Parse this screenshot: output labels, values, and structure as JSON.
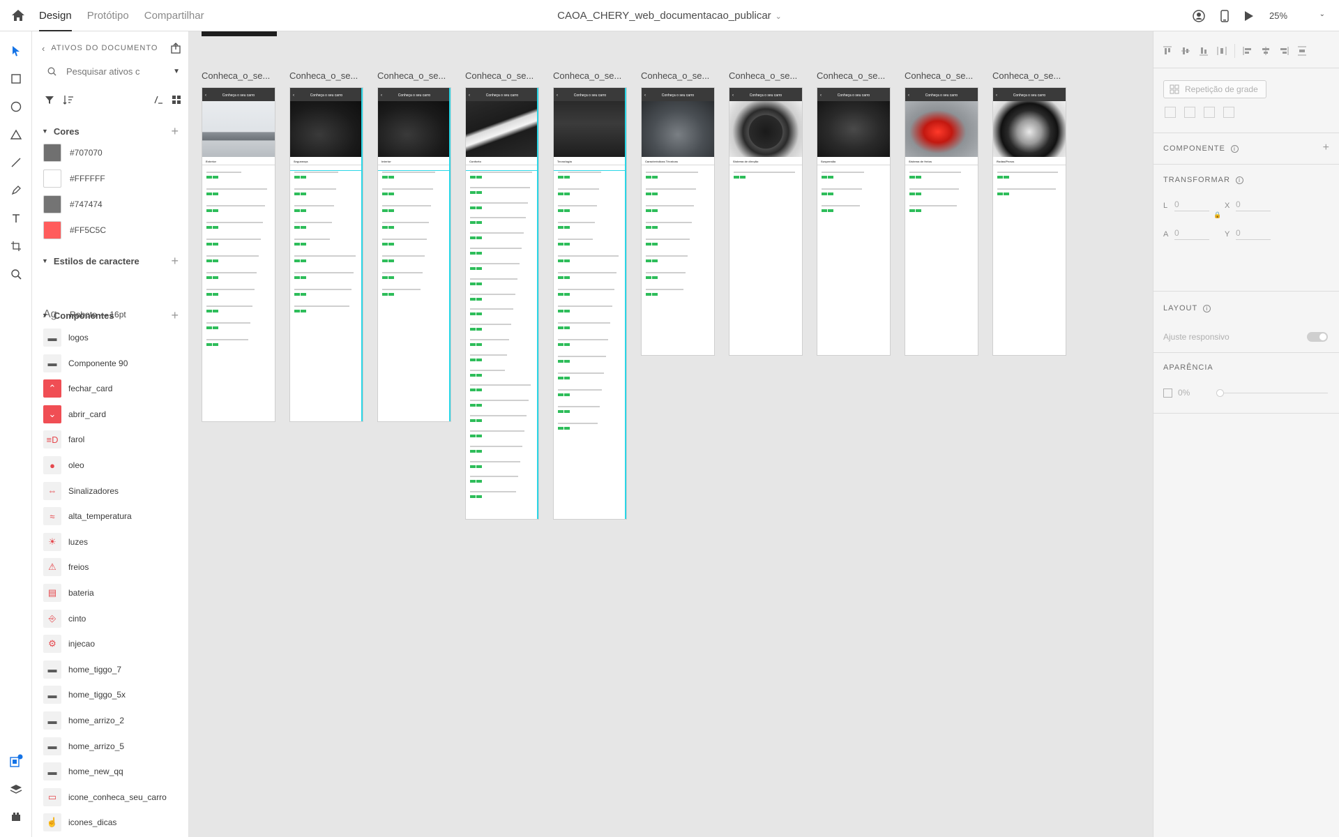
{
  "app": {
    "tabs": [
      {
        "label": "Design",
        "active": true
      },
      {
        "label": "Protótipo",
        "active": false
      },
      {
        "label": "Compartilhar",
        "active": false
      }
    ],
    "document_title": "CAOA_CHERY_web_documentacao_publicar",
    "zoom": "25%"
  },
  "assets": {
    "title": "ATIVOS DO DOCUMENTO",
    "search_placeholder": "Pesquisar ativos c",
    "colors_title": "Cores",
    "colors": [
      {
        "label": "#707070",
        "hex": "#707070"
      },
      {
        "label": "#FFFFFF",
        "hex": "#FFFFFF"
      },
      {
        "label": "#747474",
        "hex": "#747474"
      },
      {
        "label": "#FF5C5C",
        "hex": "#FF5C5C"
      }
    ],
    "char_styles_title": "Estilos de caractere",
    "char_style": {
      "glyph": "Ag",
      "label": "Roboto — 16pt"
    },
    "components_title": "Componentes",
    "components": [
      {
        "label": "logos",
        "icon": "logos-icon"
      },
      {
        "label": "Componente 90",
        "icon": "component-icon"
      },
      {
        "label": "fechar_card",
        "icon": "chevron-up-icon"
      },
      {
        "label": "abrir_card",
        "icon": "chevron-down-icon"
      },
      {
        "label": "farol",
        "icon": "headlight-icon"
      },
      {
        "label": "oleo",
        "icon": "oil-can-icon"
      },
      {
        "label": "Sinalizadores",
        "icon": "turn-signal-icon"
      },
      {
        "label": "alta_temperatura",
        "icon": "temperature-icon"
      },
      {
        "label": "luzes",
        "icon": "light-icon"
      },
      {
        "label": "freios",
        "icon": "brake-warning-icon"
      },
      {
        "label": "bateria",
        "icon": "battery-icon"
      },
      {
        "label": "cinto",
        "icon": "seatbelt-icon"
      },
      {
        "label": "injecao",
        "icon": "engine-icon"
      },
      {
        "label": "home_tiggo_7",
        "icon": "car-icon"
      },
      {
        "label": "home_tiggo_5x",
        "icon": "car-icon"
      },
      {
        "label": "home_arrizo_2",
        "icon": "car-icon"
      },
      {
        "label": "home_arrizo_5",
        "icon": "car-icon"
      },
      {
        "label": "home_new_qq",
        "icon": "car-icon"
      },
      {
        "label": "icone_conheca_seu_carro",
        "icon": "car-outline-icon"
      },
      {
        "label": "icones_dicas",
        "icon": "thumbs-up-icon"
      }
    ]
  },
  "canvas": {
    "artboards": [
      {
        "label": "Conheca_o_se...",
        "header": "Conheça o seu carro",
        "section": "Exterior",
        "rows": 11,
        "selected": false,
        "photo": "car-side"
      },
      {
        "label": "Conheca_o_se...",
        "header": "Conheça o seu carro",
        "section": "Segurança",
        "rows": 9,
        "selected": true,
        "photo": "seats"
      },
      {
        "label": "Conheca_o_se...",
        "header": "Conheça o seu carro",
        "section": "Interior",
        "rows": 8,
        "selected": true,
        "photo": "seats"
      },
      {
        "label": "Conheca_o_se...",
        "header": "Conheça o seu carro",
        "section": "Conforto",
        "rows": 22,
        "selected": true,
        "photo": "sunroof"
      },
      {
        "label": "Conheca_o_se...",
        "header": "Conheça o seu carro",
        "section": "Tecnologia",
        "rows": 16,
        "selected": true,
        "photo": "dashboard"
      },
      {
        "label": "Conheca_o_se...",
        "header": "Conheça o seu carro",
        "section": "Características Técnicas",
        "rows": 8,
        "selected": false,
        "photo": "car-front"
      },
      {
        "label": "Conheca_o_se...",
        "header": "Conheça o seu carro",
        "section": "Sistema de direção",
        "rows": 1,
        "selected": false,
        "photo": "wheel"
      },
      {
        "label": "Conheca_o_se...",
        "header": "Conheça o seu carro",
        "section": "Suspensão",
        "rows": 3,
        "selected": false,
        "photo": "engine"
      },
      {
        "label": "Conheca_o_se...",
        "header": "Conheça o seu carro",
        "section": "Sistema de freios",
        "rows": 3,
        "selected": false,
        "photo": "taillight"
      },
      {
        "label": "Conheca_o_se...",
        "header": "Conheça o seu carro",
        "section": "Rodas/Pneus",
        "rows": 2,
        "selected": false,
        "photo": "rim"
      }
    ]
  },
  "inspector": {
    "grid_repeat_label": "Repetição de grade",
    "component_title": "COMPONENTE",
    "transform_title": "TRANSFORMAR",
    "fields": {
      "l_label": "L",
      "l_value": "0",
      "x_label": "X",
      "x_value": "0",
      "a_label": "A",
      "a_value": "0",
      "y_label": "Y",
      "y_value": "0"
    },
    "layout_title": "LAYOUT",
    "responsive_label": "Ajuste responsivo",
    "appearance_title": "APARÊNCIA",
    "opacity": "0%"
  }
}
